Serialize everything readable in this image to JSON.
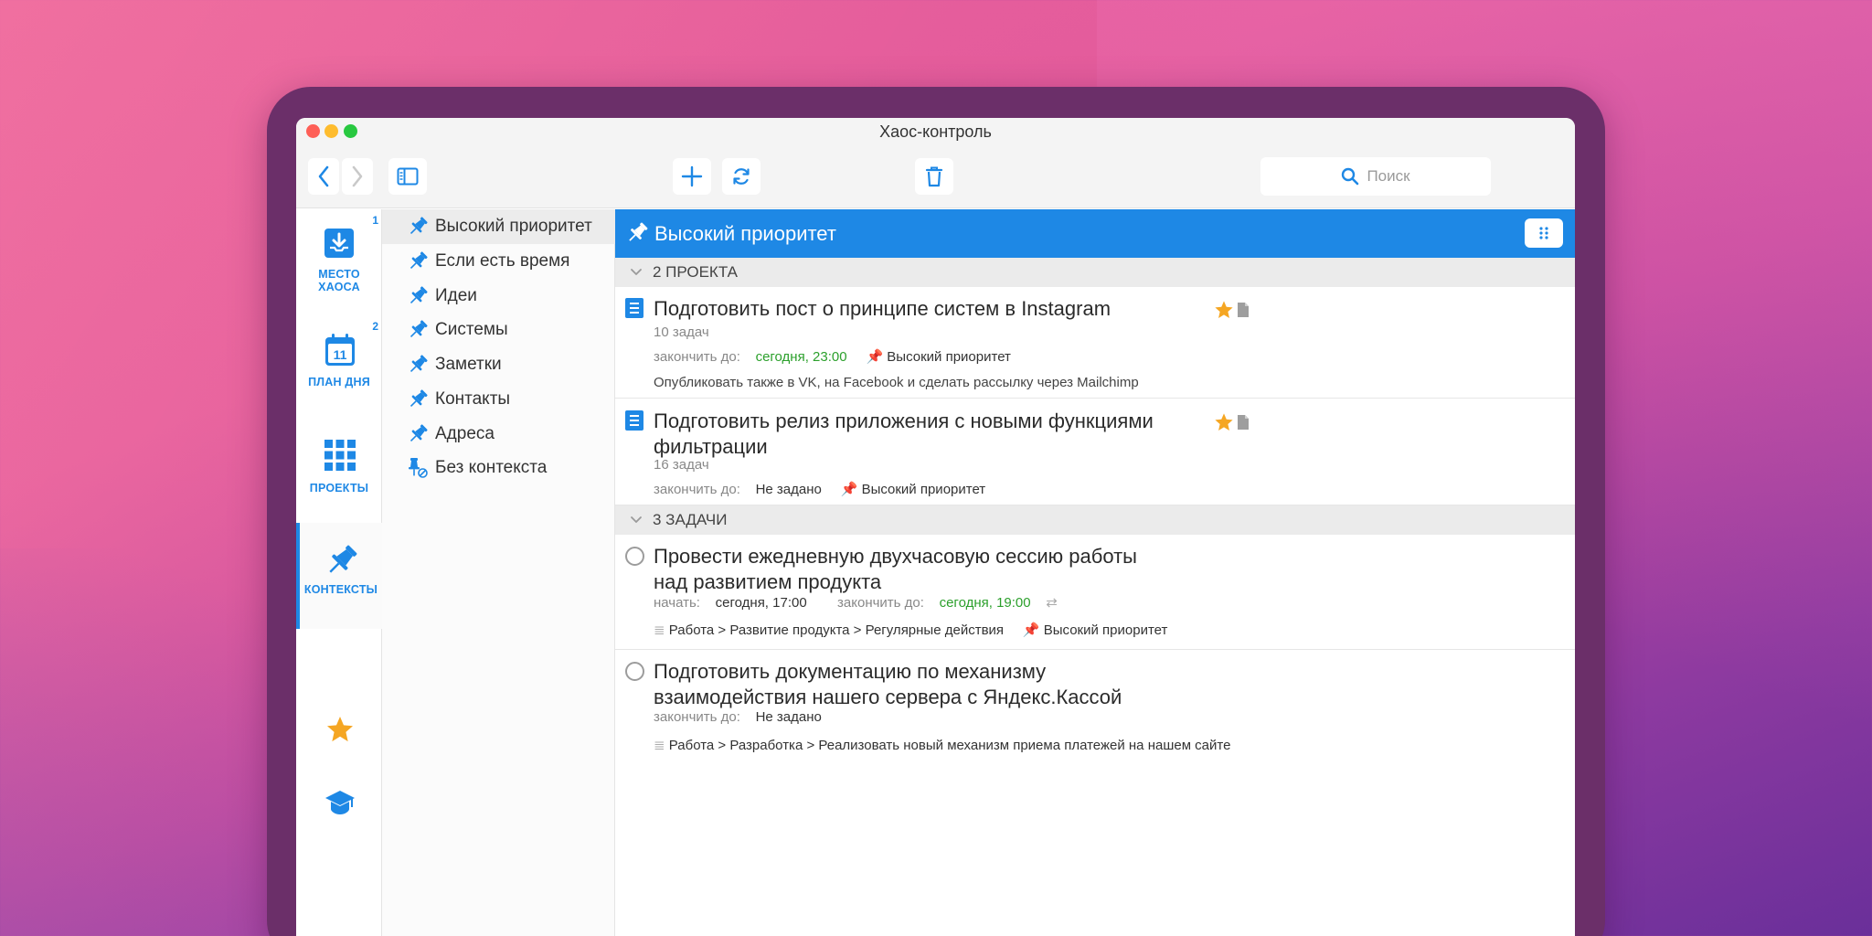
{
  "window": {
    "title": "Хаос-контроль"
  },
  "toolbar": {
    "back_icon": "chevron-left-icon",
    "forward_icon": "chevron-right-icon",
    "sidebar_toggle_icon": "sidebar-icon",
    "add_icon": "plus-icon",
    "sync_icon": "refresh-icon",
    "delete_icon": "trash-icon",
    "search_placeholder": "Поиск"
  },
  "sidebar": {
    "items": [
      {
        "label": "МЕСТО ХАОСА",
        "badge": "1",
        "icon": "inbox-icon"
      },
      {
        "label": "ПЛАН ДНЯ",
        "badge": "2",
        "icon": "calendar-icon",
        "day": "11"
      },
      {
        "label": "ПРОЕКТЫ",
        "badge": "",
        "icon": "grid-icon"
      },
      {
        "label": "КОНТЕКСТЫ",
        "badge": "",
        "icon": "pin-icon",
        "active": true
      }
    ],
    "bottom": [
      {
        "icon": "star-icon"
      },
      {
        "icon": "graduation-cap-icon"
      }
    ]
  },
  "contexts": {
    "items": [
      {
        "label": "Высокий приоритет",
        "selected": true
      },
      {
        "label": "Если есть время"
      },
      {
        "label": "Идеи"
      },
      {
        "label": "Системы"
      },
      {
        "label": "Заметки"
      },
      {
        "label": "Контакты"
      },
      {
        "label": "Адреса"
      },
      {
        "label": "Без контекста"
      }
    ]
  },
  "main": {
    "title": "Высокий приоритет",
    "groups": [
      {
        "label": "2 ПРОЕКТА"
      },
      {
        "label": "3 ЗАДАЧИ"
      }
    ],
    "projects": [
      {
        "title": "Подготовить пост о принципе систем в Instagram",
        "count": "10 задач",
        "due_label": "закончить до:",
        "due_value": "сегодня, 23:00",
        "context": "Высокий приоритет",
        "note": "Опубликовать также в VK, на Facebook и сделать рассылку через Mailchimp"
      },
      {
        "title": "Подготовить релиз приложения с новыми функциями фильтрации",
        "count": "16 задач",
        "due_label": "закончить до:",
        "due_value": "Не задано",
        "context": "Высокий приоритет"
      }
    ],
    "tasks": [
      {
        "title": "Провести ежедневную двухчасовую сессию работы над развитием продукта",
        "start_label": "начать:",
        "start_value": "сегодня, 17:00",
        "due_label": "закончить до:",
        "due_value": "сегодня, 19:00",
        "path": "Работа > Развитие продукта > Регулярные действия",
        "context": "Высокий приоритет"
      },
      {
        "title": "Подготовить документацию по механизму взаимодействия нашего сервера с Яндекс.Кассой",
        "due_label": "закончить до:",
        "due_value": "Не задано",
        "path": "Работа > Разработка > Реализовать новый механизм приема платежей на нашем сайте"
      }
    ]
  },
  "colors": {
    "accent": "#1e88e5",
    "star": "#f5a623",
    "green": "#2ca02c"
  }
}
